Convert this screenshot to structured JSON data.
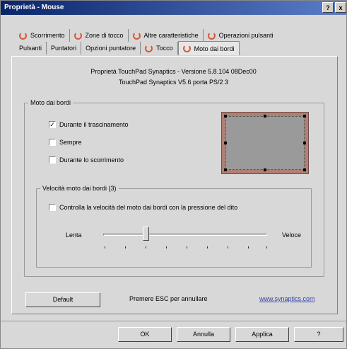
{
  "window": {
    "title": "Proprietà - Mouse",
    "help": "?",
    "close": "x"
  },
  "tabs_row1": [
    "Scorrimento",
    "Zone di tocco",
    "Altre caratteristiche",
    "Operazioni pulsanti"
  ],
  "tabs_row2": [
    "Pulsanti",
    "Puntatori",
    "Opzioni puntatore",
    "Tocco",
    "Moto dai bordi"
  ],
  "info": {
    "line1": "Proprietà TouchPad Synaptics - Versione 5.8.104 08Dec00",
    "line2": "TouchPad Synaptics V5.6 porta PS/2 3"
  },
  "moto": {
    "group_label": "Moto dai bordi",
    "opt1": "Durante il trascinamento",
    "opt1_checked": "✓",
    "opt2": "Sempre",
    "opt3": "Durante lo scorrimento"
  },
  "velocity": {
    "group_label": "Velocità moto dai bordi (3)",
    "pressure_label": "Controlla la velocità del moto dai bordi con la pressione del dito",
    "slow": "Lenta",
    "fast": "Veloce",
    "value": 3
  },
  "footer": {
    "default_button": "Default",
    "esc_hint": "Premere ESC per annullare",
    "link": "www.synaptics.com",
    "ok": "OK",
    "cancel": "Annulla",
    "apply": "Applica",
    "help": "?"
  }
}
